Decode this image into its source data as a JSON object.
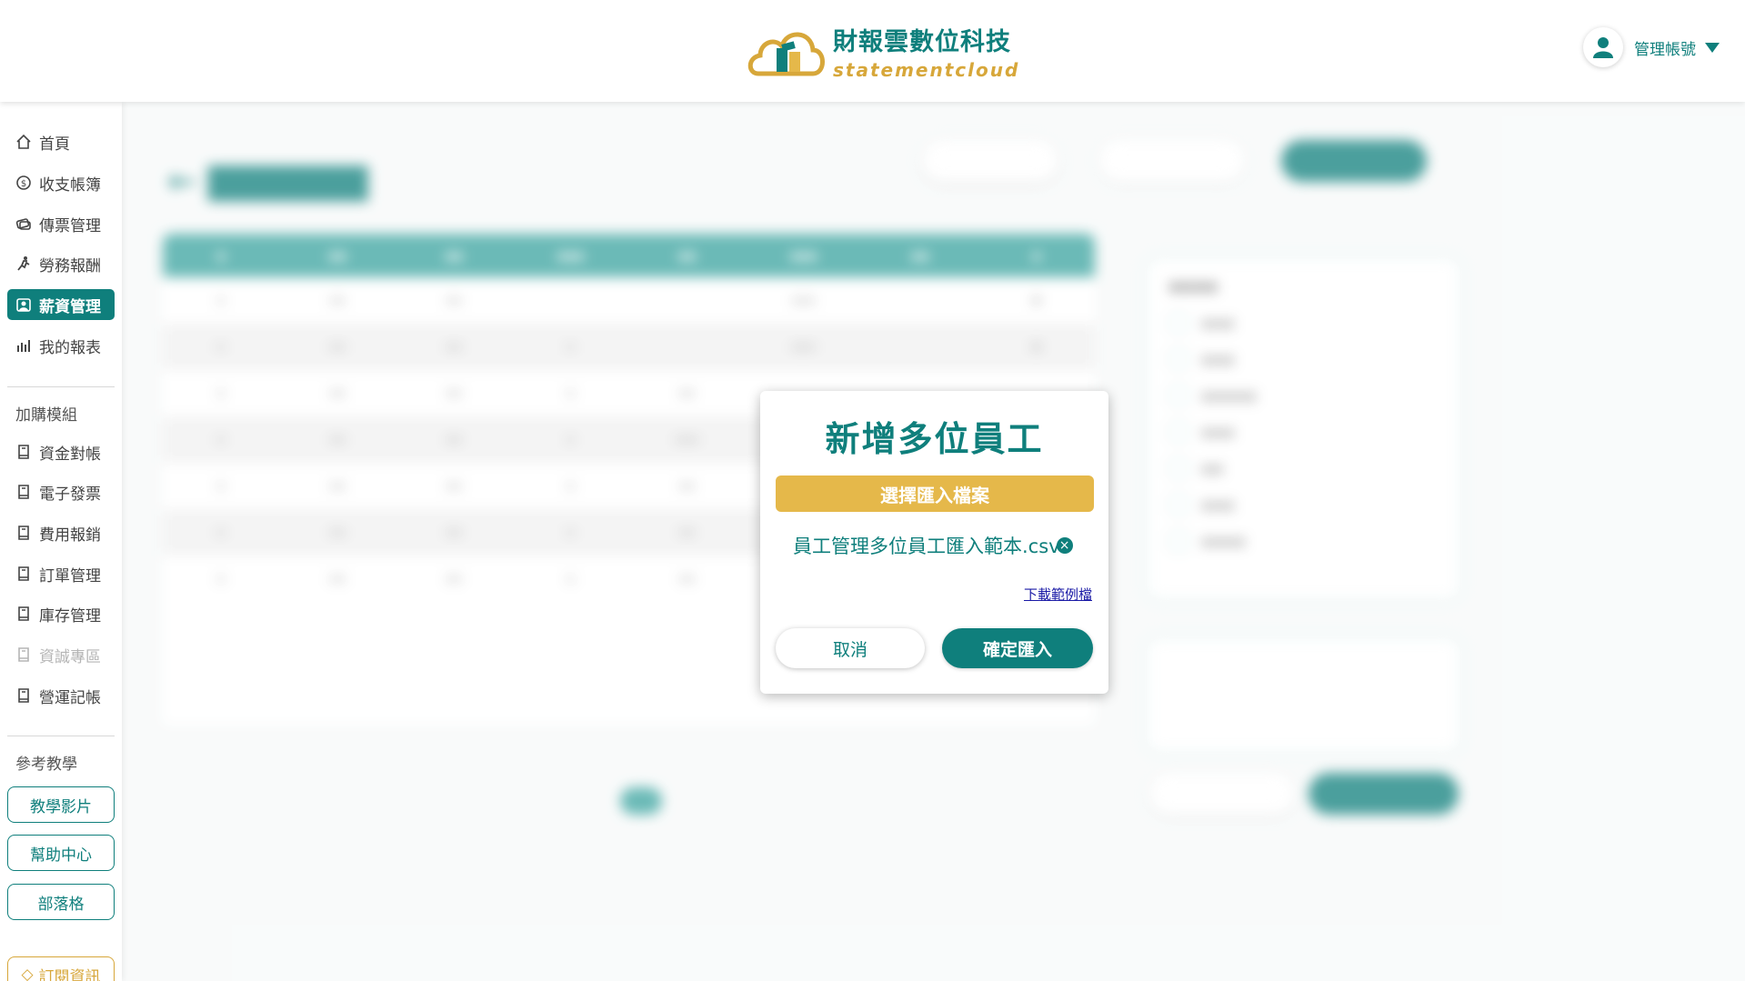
{
  "header": {
    "brand_name": "財報雲數位科技",
    "brand_en": "statementcloud",
    "account_label": "管理帳號"
  },
  "sidebar": {
    "main_items": [
      {
        "label": "首頁",
        "icon": "home-icon"
      },
      {
        "label": "收支帳簿",
        "icon": "coin-icon"
      },
      {
        "label": "傳票管理",
        "icon": "voucher-icon"
      },
      {
        "label": "勞務報酬",
        "icon": "runner-icon"
      },
      {
        "label": "薪資管理",
        "icon": "salary-icon",
        "active": true
      },
      {
        "label": "我的報表",
        "icon": "chart-icon"
      }
    ],
    "addon_section_label": "加購模組",
    "addon_items": [
      {
        "label": "資金對帳",
        "icon": "book-icon"
      },
      {
        "label": "電子發票",
        "icon": "book-icon"
      },
      {
        "label": "費用報銷",
        "icon": "book-icon"
      },
      {
        "label": "訂單管理",
        "icon": "book-icon"
      },
      {
        "label": "庫存管理",
        "icon": "book-icon"
      },
      {
        "label": "資誠專區",
        "icon": "book-icon",
        "disabled": true
      },
      {
        "label": "營運記帳",
        "icon": "book-icon"
      }
    ],
    "reference_section_label": "參考教學",
    "reference_buttons": [
      "教學影片",
      "幫助中心",
      "部落格"
    ],
    "subscription_label": "訂閱資訊"
  },
  "modal": {
    "title": "新增多位員工",
    "choose_file_label": "選擇匯入檔案",
    "file_name": "員工管理多位員工匯入範本.csv",
    "download_sample_label": "下載範例檔",
    "cancel_label": "取消",
    "confirm_label": "確定匯入"
  },
  "colors": {
    "brand_teal": "#0f7f7c",
    "brand_gold": "#e5b84a",
    "link_blue": "#1a1aa6"
  }
}
